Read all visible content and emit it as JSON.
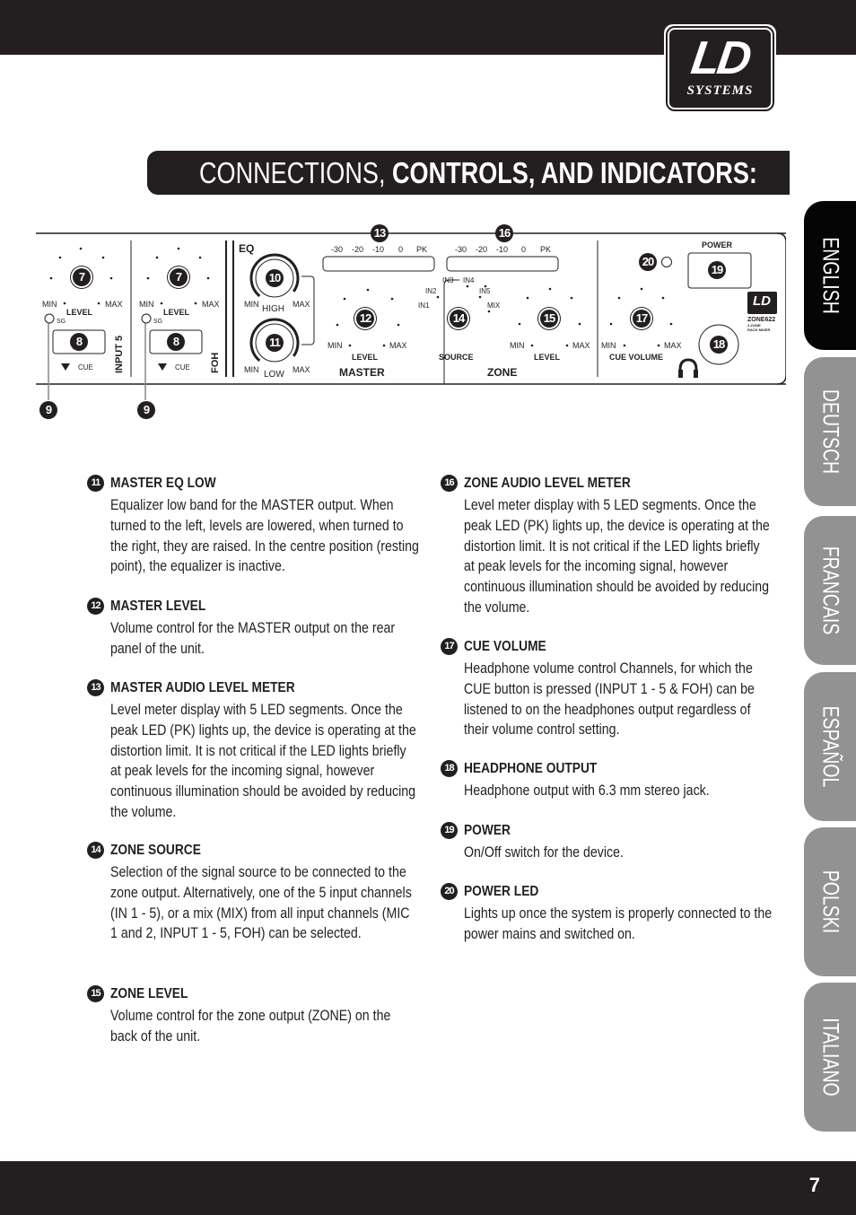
{
  "header": {
    "logo": {
      "main": "LD",
      "sub": "SYSTEMS"
    },
    "title_light": "CONNECTIONS, ",
    "title_bold": "CONTROLS, AND INDICATORS:"
  },
  "language_tabs": [
    {
      "label": "ENGLISH",
      "active": true
    },
    {
      "label": "DEUTSCH",
      "active": false
    },
    {
      "label": "FRANCAIS",
      "active": false
    },
    {
      "label": "ESPAÑOL",
      "active": false
    },
    {
      "label": "POLSKI",
      "active": false
    },
    {
      "label": "ITALIANO",
      "active": false
    }
  ],
  "panel": {
    "channel_input5": {
      "min": "MIN",
      "max": "MAX",
      "level": "LEVEL",
      "sg": "SG",
      "cue": "CUE",
      "name": "INPUT 5",
      "knob_num": "7",
      "button_num": "8",
      "callout": "9"
    },
    "channel_foh": {
      "min": "MIN",
      "max": "MAX",
      "level": "LEVEL",
      "sg": "SG",
      "cue": "CUE",
      "name": "FOH",
      "knob_num": "7",
      "button_num": "8",
      "callout": "9"
    },
    "eq": {
      "title": "EQ",
      "high": "HIGH",
      "low": "LOW",
      "min": "MIN",
      "max": "MAX",
      "high_num": "10",
      "low_num": "11"
    },
    "master": {
      "meter_ticks": [
        "-30",
        "-20",
        "-10",
        "0",
        "PK"
      ],
      "meter_num": "13",
      "level_num": "12",
      "min": "MIN",
      "max": "MAX",
      "level": "LEVEL",
      "name": "MASTER"
    },
    "zone": {
      "meter_ticks": [
        "-30",
        "-20",
        "-10",
        "0",
        "PK"
      ],
      "meter_num": "16",
      "source_num": "14",
      "level_num": "15",
      "source_positions": [
        "IN1",
        "IN2",
        "IN3",
        "IN4",
        "IN5",
        "MIX"
      ],
      "source": "SOURCE",
      "level": "LEVEL",
      "min": "MIN",
      "max": "MAX",
      "name": "ZONE"
    },
    "right": {
      "power": "POWER",
      "power_num": "19",
      "led_num": "20",
      "cue_num": "17",
      "phones_num": "18",
      "min": "MIN",
      "max": "MAX",
      "cue_volume": "CUE VOLUME",
      "badge_ld": "LD",
      "badge_model": "ZONE622",
      "badge_sub1": "2-ZONE",
      "badge_sub2": "RACK MIXER"
    }
  },
  "items": [
    {
      "num": "11",
      "title": "MASTER EQ LOW",
      "body": "Equalizer low band for the MASTER output. When turned to the left, levels are lowered, when turned to the right, they are raised. In the centre position (resting point), the equalizer is inactive."
    },
    {
      "num": "12",
      "title": "MASTER LEVEL",
      "body": "Volume control for the MASTER output on the rear panel of the unit."
    },
    {
      "num": "13",
      "title": "MASTER AUDIO LEVEL METER",
      "body": "Level meter display with 5 LED segments. Once the peak LED (PK) lights up, the device is operating at the distortion limit. It is not critical if the LED lights briefly at peak levels for the incoming signal, however continuous illumination should be avoided by reducing the volume."
    },
    {
      "num": "14",
      "title": "ZONE SOURCE",
      "body": "Selection of the signal source to be connected to the zone output. Alternatively, one of the 5 input channels (IN 1 - 5), or a mix (MIX) from all input channels (MIC 1 and 2, INPUT 1 - 5, FOH) can be selected."
    },
    {
      "num": "15",
      "title": "ZONE LEVEL",
      "body": "Volume control for the zone output (ZONE) on the back of the unit."
    },
    {
      "num": "16",
      "title": "ZONE AUDIO LEVEL METER",
      "body": "Level meter display with 5 LED segments. Once the peak LED (PK) lights up, the device is operating at the distortion limit. It is not critical if the LED lights briefly at peak levels for the incoming signal, however continuous illumination should be avoided by reducing the volume."
    },
    {
      "num": "17",
      "title": "CUE VOLUME",
      "body": "Headphone volume control Channels, for which the CUE button is pressed (INPUT 1 - 5 & FOH) can be listened to on the headphones output regardless of their volume control setting."
    },
    {
      "num": "18",
      "title": "HEADPHONE OUTPUT",
      "body": "Headphone output with 6.3 mm stereo jack."
    },
    {
      "num": "19",
      "title": "POWER",
      "body": "On/Off switch for the device."
    },
    {
      "num": "20",
      "title": "POWER LED",
      "body": "Lights up once the system is properly connected to the power mains and switched on."
    }
  ],
  "footer": {
    "page_number": "7"
  }
}
